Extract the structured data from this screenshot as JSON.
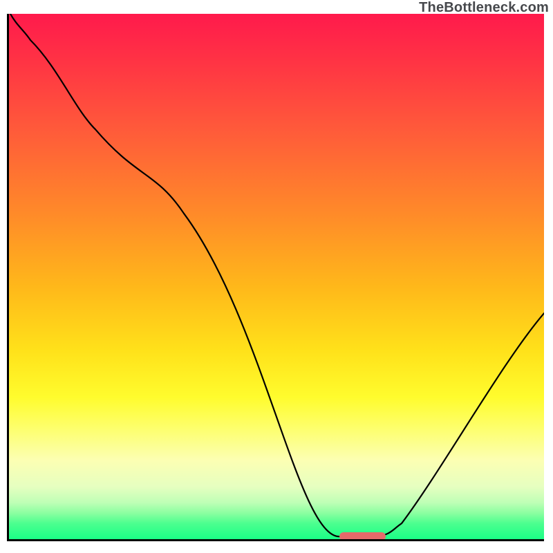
{
  "watermark": "TheBottleneck.com",
  "chart_data": {
    "type": "line",
    "x": [
      0,
      31,
      125,
      253,
      478,
      522,
      568,
      774
    ],
    "values": [
      100.5,
      95,
      78,
      62,
      0.5,
      0.5,
      3,
      43
    ],
    "ylim": [
      0,
      100
    ],
    "xlim": [
      0,
      774
    ],
    "axes_visible": {
      "x": true,
      "y": true
    },
    "grid": false,
    "title": "",
    "xlabel": "",
    "ylabel": "",
    "marker": {
      "x_start": 478,
      "x_end": 545,
      "y": 0.5
    },
    "gradient": {
      "stops": [
        {
          "color": "#ff1a4c",
          "at": 0
        },
        {
          "color": "#ffe11a",
          "at": 64
        },
        {
          "color": "#1aff86",
          "at": 100
        }
      ]
    }
  }
}
